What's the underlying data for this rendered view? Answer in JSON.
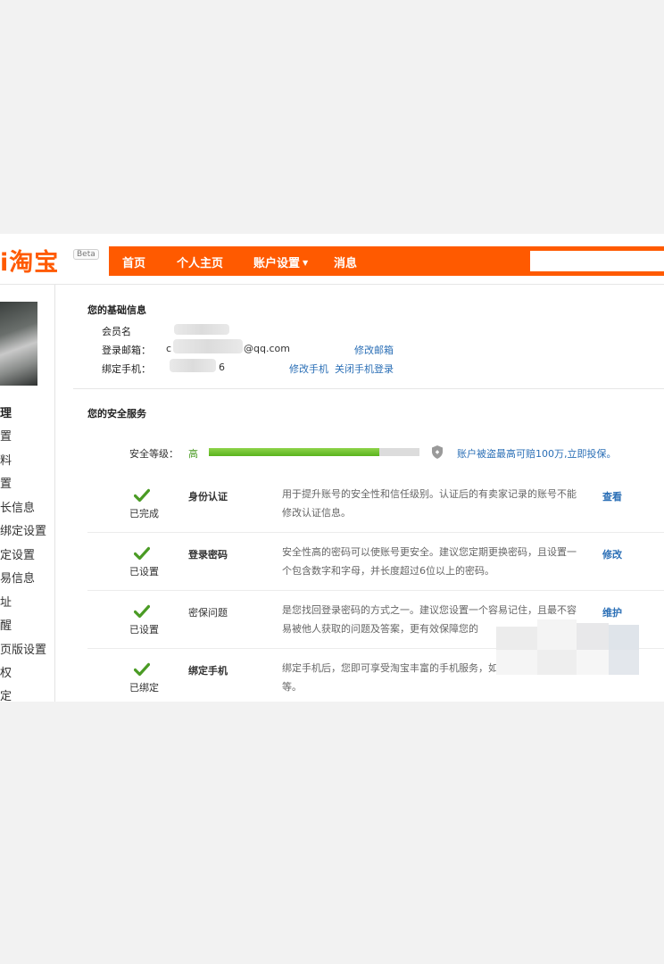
{
  "header": {
    "logo_text": "淘宝",
    "beta_badge": "Beta",
    "nav": [
      {
        "label": "首页"
      },
      {
        "label": "个人主页"
      },
      {
        "label": "账户设置"
      },
      {
        "label": "消息"
      }
    ],
    "search_value": ""
  },
  "sidebar": {
    "heading": "理",
    "items": [
      {
        "label": "置"
      },
      {
        "label": "料"
      },
      {
        "label": "置"
      },
      {
        "label": "长信息"
      },
      {
        "label": "绑定设置"
      },
      {
        "label": "定设置"
      },
      {
        "label": "易信息"
      },
      {
        "label": "址"
      },
      {
        "label": "醒"
      },
      {
        "label": "页版设置"
      },
      {
        "label": "权"
      },
      {
        "label": "定"
      }
    ]
  },
  "basic_info": {
    "title": "您的基础信息",
    "member_label": "会员名",
    "email_label": "登录邮箱：",
    "email_value_prefix": "c",
    "email_value_suffix": "@qq.com",
    "email_action": "修改邮箱",
    "phone_label": "绑定手机：",
    "phone_value_suffix": "6",
    "phone_actions": [
      "修改手机",
      "关闭手机登录"
    ]
  },
  "security": {
    "title": "您的安全服务",
    "level_label": "安全等级：",
    "level_value": "高",
    "level_progress": 0.81,
    "promo_text": "账户被盗最高可赔100万,立即投保。",
    "services": [
      {
        "status": "已完成",
        "name": "身份认证",
        "desc": "用于提升账号的安全性和信任级别。认证后的有卖家记录的账号不能修改认证信息。",
        "action": "查看"
      },
      {
        "status": "已设置",
        "name": "登录密码",
        "desc": "安全性高的密码可以使账号更安全。建议您定期更换密码，且设置一个包含数字和字母，并长度超过6位以上的密码。",
        "action": "修改"
      },
      {
        "status": "已设置",
        "name": "密保问题",
        "desc": "是您找回登录密码的方式之一。建议您设置一个容易记住，且最不容易被他人获取的问题及答案，更有效保障您的",
        "action": "维护"
      },
      {
        "status": "已绑定",
        "name": "绑定手机",
        "desc": "绑定手机后，您即可享受淘宝丰富的手机服务，如",
        "desc_line2": "等。",
        "action": ""
      }
    ]
  },
  "colors": {
    "brand_orange": "#ff5a00",
    "link_blue": "#2b6fb6",
    "progress_green": "#5ab31e",
    "check_green": "#4a9b24"
  }
}
